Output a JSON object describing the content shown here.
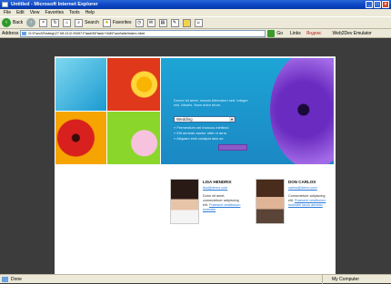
{
  "window": {
    "title": "Untitled - Microsoft Internet Explorer"
  },
  "menu": [
    "File",
    "Edit",
    "View",
    "Favorites",
    "Tools",
    "Help"
  ],
  "toolbar": {
    "back": "Back",
    "search": "Search",
    "favorites": "Favorites"
  },
  "address": {
    "label": "Address",
    "url": "D:\\Fund\\Testing\\27.08.11\\2.0\\597.Flash3\\Flash+Vid\\Fund\\site\\index.html",
    "go": "Go",
    "links": "Links",
    "extra": "Яндекс",
    "emulator": "Web2Dev Emulator"
  },
  "site": {
    "intro": "Donec sit amet, mauris bibendum sed. Integer nisl. Mauris. Nam dolor etum.",
    "select": "Wedding",
    "bullets": [
      "Fermentum vel rhoncus eleifend",
      "Elit aenean auctor nibh ut arna",
      "Aliquam erat volutpat duis ac"
    ],
    "people": [
      {
        "name": "LISA HENDRIX",
        "email": "lisa@demo.com",
        "desc": "Dolor sit amet, consectetuer adipiscing elit.",
        "link": "Praesent vestibulum molestie"
      },
      {
        "name": "DON CARLOS",
        "email": "carlos@demo.com",
        "desc": "Consectetuer adipiscing elit.",
        "link": "Praesent vestibulum molestie lacus aenean"
      }
    ]
  },
  "status": {
    "text": "Done",
    "zone": "My Computer"
  }
}
